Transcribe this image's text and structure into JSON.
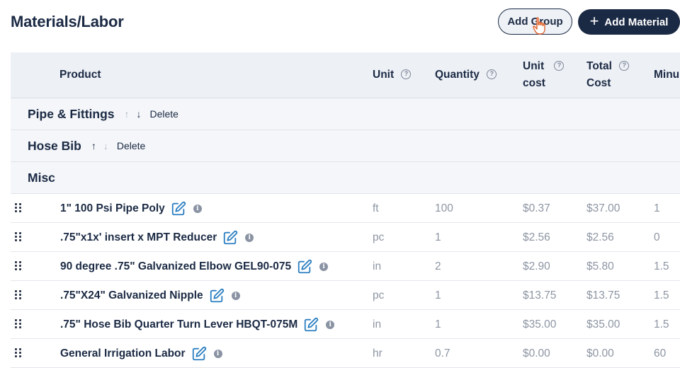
{
  "header": {
    "title": "Materials/Labor",
    "add_group_label": "Add Group",
    "add_material_label": "Add Material"
  },
  "columns": {
    "product": "Product",
    "unit": "Unit",
    "quantity": "Quantity",
    "unit_cost_1": "Unit",
    "unit_cost_2": "cost",
    "total_cost_1": "Total",
    "total_cost_2": "Cost",
    "minutes": "Minu",
    "help_glyph": "?"
  },
  "groups": [
    {
      "name": "Pipe & Fittings",
      "up": "↑",
      "down": "↓",
      "delete": "Delete"
    },
    {
      "name": "Hose Bib",
      "up": "↑",
      "down": "↓",
      "delete": "Delete"
    },
    {
      "name": "Misc"
    }
  ],
  "items": [
    {
      "product": "1\" 100 Psi Pipe Poly",
      "unit": "ft",
      "quantity": "100",
      "unit_cost": "$0.37",
      "total_cost": "$37.00",
      "minutes": "1"
    },
    {
      "product": ".75\"x1x' insert x MPT Reducer",
      "unit": "pc",
      "quantity": "1",
      "unit_cost": "$2.56",
      "total_cost": "$2.56",
      "minutes": "0"
    },
    {
      "product": "90 degree .75\" Galvanized Elbow GEL90-075",
      "unit": "in",
      "quantity": "2",
      "unit_cost": "$2.90",
      "total_cost": "$5.80",
      "minutes": "1.5"
    },
    {
      "product": ".75\"X24\" Galvanized Nipple",
      "unit": "pc",
      "quantity": "1",
      "unit_cost": "$13.75",
      "total_cost": "$13.75",
      "minutes": "1.5"
    },
    {
      "product": ".75\" Hose Bib Quarter Turn Lever HBQT-075M",
      "unit": "in",
      "quantity": "1",
      "unit_cost": "$35.00",
      "total_cost": "$35.00",
      "minutes": "1.5"
    },
    {
      "product": "General Irrigation Labor",
      "unit": "hr",
      "quantity": "0.7",
      "unit_cost": "$0.00",
      "total_cost": "$0.00",
      "minutes": "60"
    }
  ],
  "info_glyph": "i",
  "colors": {
    "primary": "#1b2a44",
    "accent": "#2d7fc1",
    "muted_text": "#8d95a3",
    "header_bg": "#edf0f5"
  }
}
